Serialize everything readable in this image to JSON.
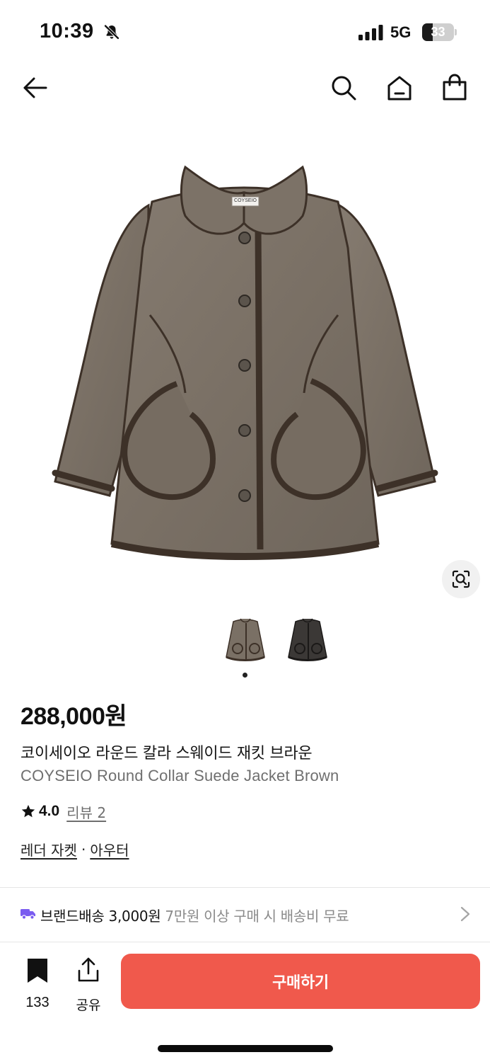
{
  "status_bar": {
    "time": "10:39",
    "network": "5G",
    "battery": "33",
    "battery_percent": 33,
    "icons": [
      "bell-slash-icon",
      "signal-bars-icon",
      "battery-icon"
    ]
  },
  "nav": {
    "icons": [
      "back-arrow-icon",
      "search-icon",
      "home-icon",
      "shopping-bag-icon"
    ]
  },
  "product": {
    "brand_tag": "COYSEIO",
    "price_number": "288,000",
    "price_unit": "원",
    "name_ko": "코이세이오 라운드 칼라 스웨이드 재킷 브라운",
    "name_en": "COYSEIO Round Collar Suede Jacket Brown",
    "rating": "4.0",
    "review_label": "리뷰 2",
    "categories": [
      "레더 자켓",
      "아우터"
    ],
    "category_separator": "·",
    "image_count": 2,
    "active_image_index": 0,
    "colors": {
      "main": "#7b7267",
      "trim": "#3d3128",
      "dark_variant": "#3b3836"
    }
  },
  "shipping": {
    "label": "브랜드배송 3,000원",
    "sub": "7만원 이상 구매 시 배송비 무료",
    "icon_color": "#7a5cf0"
  },
  "bottom_bar": {
    "bookmark_count": "133",
    "share_label": "공유",
    "buy_label": "구매하기",
    "buy_color": "#f0594c"
  }
}
